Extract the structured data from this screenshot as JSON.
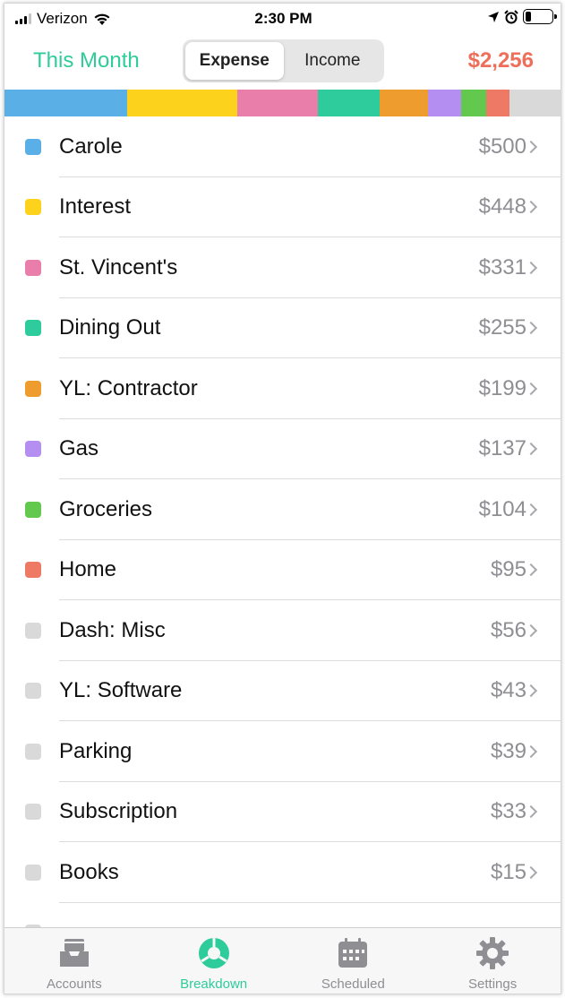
{
  "status_bar": {
    "carrier": "Verizon",
    "time": "2:30 PM"
  },
  "header": {
    "period": "This Month",
    "segments": [
      {
        "label": "Expense",
        "active": true
      },
      {
        "label": "Income",
        "active": false
      }
    ],
    "total": "$2,256"
  },
  "colors": {
    "accent": "#2ecc9a",
    "total": "#ee6e5a"
  },
  "categories": [
    {
      "name": "Carole",
      "amount": "$500",
      "color": "#5aafe6"
    },
    {
      "name": "Interest",
      "amount": "$448",
      "color": "#fcd21c"
    },
    {
      "name": "St. Vincent's",
      "amount": "$331",
      "color": "#ea7eaa"
    },
    {
      "name": "Dining Out",
      "amount": "$255",
      "color": "#2ecb9c"
    },
    {
      "name": "YL: Contractor",
      "amount": "$199",
      "color": "#ee9c2e"
    },
    {
      "name": "Gas",
      "amount": "$137",
      "color": "#b48ef0"
    },
    {
      "name": "Groceries",
      "amount": "$104",
      "color": "#62c84e"
    },
    {
      "name": "Home",
      "amount": "$95",
      "color": "#ee7a66"
    },
    {
      "name": "Dash: Misc",
      "amount": "$56",
      "color": "#d9d9d9"
    },
    {
      "name": "YL: Software",
      "amount": "$43",
      "color": "#d9d9d9"
    },
    {
      "name": "Parking",
      "amount": "$39",
      "color": "#d9d9d9"
    },
    {
      "name": "Subscription",
      "amount": "$33",
      "color": "#d9d9d9"
    },
    {
      "name": "Books",
      "amount": "$15",
      "color": "#d9d9d9"
    }
  ],
  "tabs": [
    {
      "label": "Accounts",
      "icon": "inbox-tray-icon",
      "active": false
    },
    {
      "label": "Breakdown",
      "icon": "pie-breakdown-icon",
      "active": true
    },
    {
      "label": "Scheduled",
      "icon": "calendar-icon",
      "active": false
    },
    {
      "label": "Settings",
      "icon": "gear-icon",
      "active": false
    }
  ]
}
